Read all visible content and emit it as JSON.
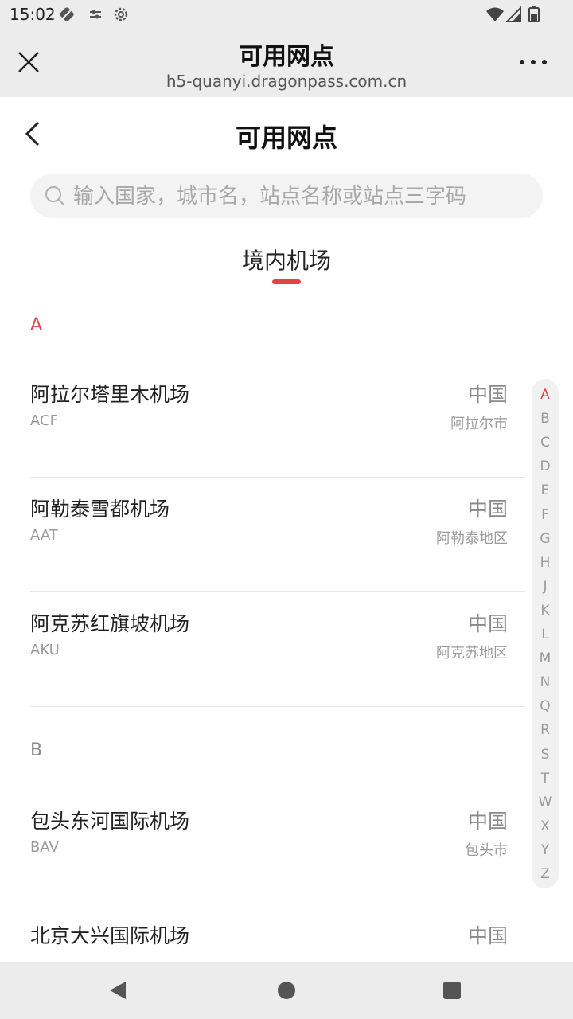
{
  "status_bar": {
    "time": "15:02",
    "icons": [
      "battery-saver-icon",
      "sliders-icon",
      "settings-icon",
      "wifi-icon",
      "signal-icon",
      "battery-icon"
    ]
  },
  "web_header": {
    "title": "可用网点",
    "url": "h5-quanyi.dragonpass.com.cn"
  },
  "page": {
    "title": "可用网点"
  },
  "search": {
    "placeholder": "输入国家，城市名，站点名称或站点三字码",
    "value": ""
  },
  "tab": {
    "label": "境内机场",
    "accent_color": "#e8404a"
  },
  "sections": [
    {
      "letter": "A",
      "active": true,
      "rows": [
        {
          "name": "阿拉尔塔里木机场",
          "code": "ACF",
          "country": "中国",
          "city": "阿拉尔市"
        },
        {
          "name": "阿勒泰雪都机场",
          "code": "AAT",
          "country": "中国",
          "city": "阿勒泰地区"
        },
        {
          "name": "阿克苏红旗坡机场",
          "code": "AKU",
          "country": "中国",
          "city": "阿克苏地区"
        }
      ]
    },
    {
      "letter": "B",
      "active": false,
      "rows": [
        {
          "name": "包头东河国际机场",
          "code": "BAV",
          "country": "中国",
          "city": "包头市"
        },
        {
          "name": "北京大兴国际机场",
          "code": "",
          "country": "中国",
          "city": ""
        }
      ]
    }
  ],
  "index_bar": {
    "letters": [
      "A",
      "B",
      "C",
      "D",
      "E",
      "F",
      "G",
      "H",
      "J",
      "K",
      "L",
      "M",
      "N",
      "Q",
      "R",
      "S",
      "T",
      "W",
      "X",
      "Y",
      "Z"
    ],
    "active": "A"
  }
}
